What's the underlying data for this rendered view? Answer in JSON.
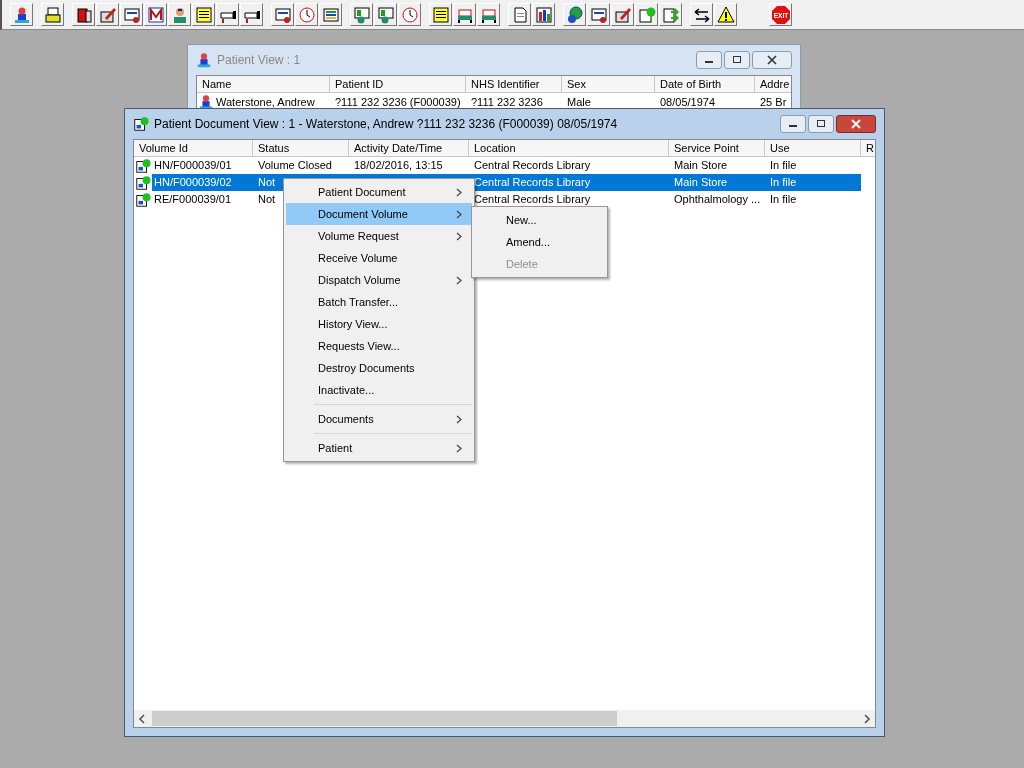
{
  "toolbar": {
    "exit_label": "EXIT"
  },
  "patient_view": {
    "title": "Patient View : 1",
    "active": false,
    "columns": [
      "Name",
      "Patient ID",
      "NHS Identifier",
      "Sex",
      "Date of Birth",
      "Addre"
    ],
    "rows": [
      {
        "cells": [
          "Waterstone, Andrew",
          "?111 232 3236 (F000039)",
          "?111 232 3236",
          "Male",
          "08/05/1974",
          "25 Br"
        ]
      }
    ]
  },
  "document_view": {
    "title": "Patient Document View : 1 - Waterstone, Andrew ?111 232 3236 (F000039) 08/05/1974",
    "active": true,
    "columns": [
      "Volume Id",
      "Status",
      "Activity Date/Time",
      "Location",
      "Service Point",
      "Use",
      "R"
    ],
    "rows": [
      {
        "cells": [
          "HN/F000039/01",
          "Volume Closed",
          "18/02/2016, 13:15",
          "Central Records Library",
          "Main Store",
          "In file"
        ],
        "selected": false
      },
      {
        "cells": [
          "HN/F000039/02",
          "Not",
          "",
          "Central Records Library",
          "Main Store",
          "In file"
        ],
        "selected": true
      },
      {
        "cells": [
          "RE/F000039/01",
          "Not",
          "",
          "Central Records Library",
          "Ophthalmology ...",
          "In file"
        ],
        "selected": false
      }
    ]
  },
  "context_menu": {
    "items": [
      {
        "label": "Patient Document",
        "selected": false,
        "has_submenu": true,
        "separator_before": false
      },
      {
        "label": "Document Volume",
        "selected": true,
        "has_submenu": true,
        "separator_before": false
      },
      {
        "label": "Volume Request",
        "selected": false,
        "has_submenu": true,
        "separator_before": false
      },
      {
        "label": "Receive Volume",
        "selected": false,
        "has_submenu": false,
        "separator_before": false
      },
      {
        "label": "Dispatch Volume",
        "selected": false,
        "has_submenu": true,
        "separator_before": false
      },
      {
        "label": "Batch Transfer...",
        "selected": false,
        "has_submenu": false,
        "separator_before": false
      },
      {
        "label": "History View...",
        "selected": false,
        "has_submenu": false,
        "separator_before": false
      },
      {
        "label": "Requests View...",
        "selected": false,
        "has_submenu": false,
        "separator_before": false
      },
      {
        "label": "Destroy Documents",
        "selected": false,
        "has_submenu": false,
        "separator_before": false
      },
      {
        "label": "Inactivate...",
        "selected": false,
        "has_submenu": false,
        "separator_before": false
      },
      {
        "label": "Documents",
        "selected": false,
        "has_submenu": true,
        "separator_before": true
      },
      {
        "label": "Patient",
        "selected": false,
        "has_submenu": true,
        "separator_before": true
      }
    ]
  },
  "submenu": {
    "items": [
      {
        "label": "New...",
        "disabled": false
      },
      {
        "label": "Amend...",
        "disabled": false
      },
      {
        "label": "Delete",
        "disabled": true
      }
    ]
  }
}
